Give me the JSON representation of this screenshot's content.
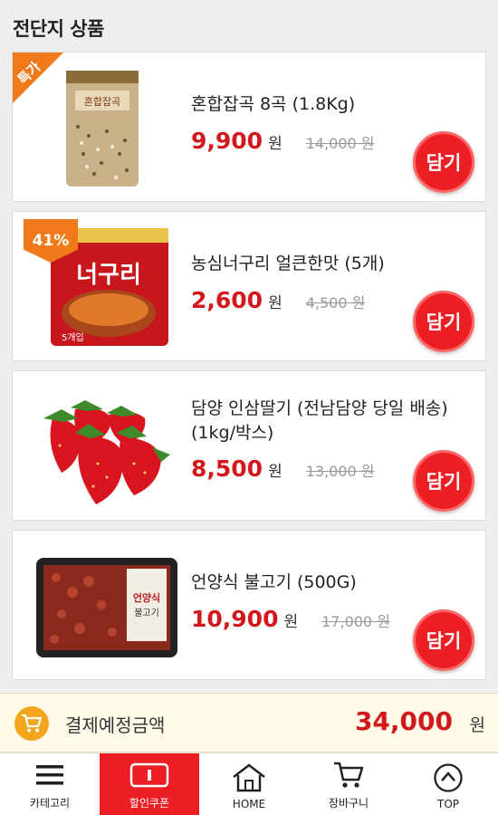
{
  "section_title": "전단지 상품",
  "products": [
    {
      "name": "혼합잡곡 8곡 (1.8Kg)",
      "price": "9,900",
      "won": "원",
      "original": "14,000 원",
      "badge": "특가",
      "cart_label": "담기"
    },
    {
      "name": "농심너구리 얼큰한맛 (5개)",
      "price": "2,600",
      "won": "원",
      "original": "4,500 원",
      "badge": "41%",
      "cart_label": "담기"
    },
    {
      "name": "담양 인삼딸기 (전남담양 당일 배송) (1kg/박스)",
      "price": "8,500",
      "won": "원",
      "original": "13,000 원",
      "cart_label": "담기"
    },
    {
      "name": "언양식 불고기 (500G)",
      "price": "10,900",
      "won": "원",
      "original": "17,000 원",
      "cart_label": "담기"
    }
  ],
  "summary": {
    "label": "결제예정금액",
    "amount": "34,000",
    "won": "원"
  },
  "nav": [
    {
      "label": "카테고리",
      "icon": "menu-icon"
    },
    {
      "label": "할인쿠폰",
      "icon": "coupon-icon",
      "active": true
    },
    {
      "label": "HOME",
      "icon": "home-icon"
    },
    {
      "label": "장바구니",
      "icon": "cart-icon"
    },
    {
      "label": "TOP",
      "icon": "top-arrow-icon"
    }
  ],
  "colors": {
    "accent": "#ec1f24",
    "price": "#d3181c",
    "badge": "#f07a1a",
    "summary_bg": "#fffbe8"
  }
}
